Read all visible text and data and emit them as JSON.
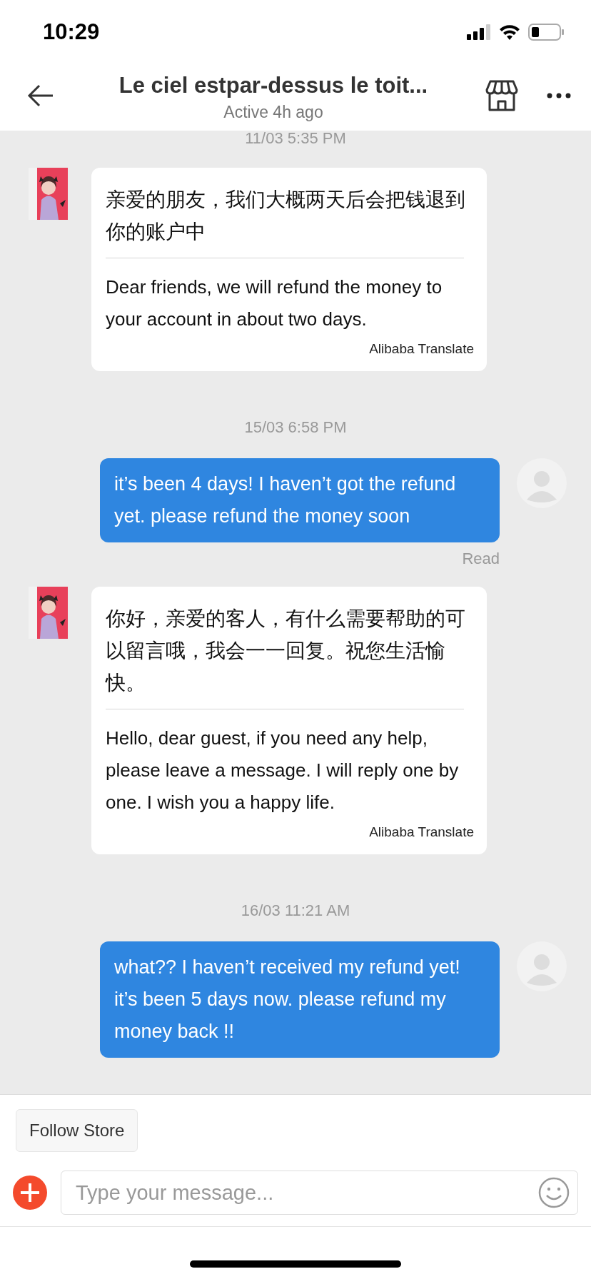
{
  "status_bar": {
    "time": "10:29"
  },
  "header": {
    "title": "Le ciel estpar-dessus le toit...",
    "subtitle": "Active 4h ago"
  },
  "messages": [
    {
      "kind": "timestamp",
      "text": "11/03 5:35 PM"
    },
    {
      "kind": "received",
      "original": "亲爱的朋友，我们大概两天后会把钱退到你的账户中",
      "translation": "Dear friends, we will refund the money to your account in about two days.",
      "translator": "Alibaba Translate"
    },
    {
      "kind": "timestamp",
      "text": "15/03 6:58 PM"
    },
    {
      "kind": "sent",
      "text": "it’s been 4 days! I haven’t got the refund yet. please refund the money soon",
      "status": "Read"
    },
    {
      "kind": "received",
      "original": "你好，亲爱的客人，有什么需要帮助的可以留言哦，我会一一回复。祝您生活愉快。",
      "translation": "Hello, dear guest, if you need any help, please leave a message. I will reply one by one. I wish you a happy life.",
      "translator": "Alibaba Translate"
    },
    {
      "kind": "timestamp",
      "text": "16/03 11:21 AM"
    },
    {
      "kind": "sent",
      "text": "what?? I haven’t received my refund yet! it’s been 5 days now. please refund my money back !!"
    }
  ],
  "follow_button": "Follow Store",
  "composer": {
    "placeholder": "Type your message..."
  }
}
